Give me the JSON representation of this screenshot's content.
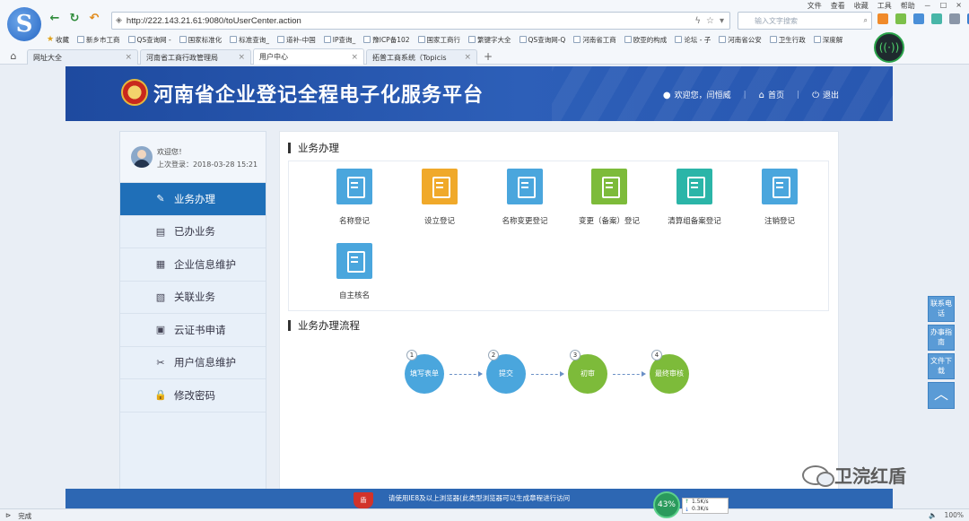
{
  "browser": {
    "system_menu": [
      "文件",
      "查看",
      "收藏",
      "工具",
      "帮助"
    ],
    "window_controls": [
      "－",
      "□",
      "×"
    ],
    "url": "http://222.143.21.61:9080/toUserCenter.action",
    "search_placeholder": "输入文字搜索",
    "bookmarks": [
      {
        "label": "收藏",
        "fav": true
      },
      {
        "label": "新乡市工商"
      },
      {
        "label": "QS查询网 -"
      },
      {
        "label": "国家标准化"
      },
      {
        "label": "标准查询_"
      },
      {
        "label": "道补-中国"
      },
      {
        "label": "IP查询_"
      },
      {
        "label": "豫ICP备102"
      },
      {
        "label": "国家工商行"
      },
      {
        "label": "繁键字大全"
      },
      {
        "label": "QS查询网-Q"
      },
      {
        "label": "河南省工商"
      },
      {
        "label": "欧亚的构成"
      },
      {
        "label": "论坛 - 子"
      },
      {
        "label": "河南省公安"
      },
      {
        "label": "卫生行政"
      },
      {
        "label": "深度解"
      }
    ],
    "tabs": [
      {
        "label": "网址大全",
        "active": false
      },
      {
        "label": "河南省工商行政管理局",
        "active": false
      },
      {
        "label": "用户中心",
        "active": true
      },
      {
        "label": "拓普工商系统（Topicis",
        "active": false
      }
    ],
    "status_left": "完成",
    "status_right": [
      "100%"
    ],
    "speed": {
      "percent": "43%",
      "up": "1.5K/s",
      "down": "0.3K/s"
    }
  },
  "header": {
    "site_title": "河南省企业登记全程电子化服务平台",
    "welcome_link": "欢迎您，闫恒威",
    "home_link": "首页",
    "logout_link": "退出"
  },
  "sidebar": {
    "welcome": "欢迎您！",
    "last_login": "上次登录：2018-03-28 15:21",
    "items": [
      {
        "label": "业务办理",
        "icon": "edit-icon",
        "glyph": "✎",
        "active": true
      },
      {
        "label": "已办业务",
        "icon": "document-icon",
        "glyph": "▤",
        "active": false
      },
      {
        "label": "企业信息维护",
        "icon": "building-icon",
        "glyph": "▦",
        "active": false
      },
      {
        "label": "关联业务",
        "icon": "search-doc-icon",
        "glyph": "▧",
        "active": false
      },
      {
        "label": "云证书申请",
        "icon": "certificate-icon",
        "glyph": "▣",
        "active": false
      },
      {
        "label": "用户信息维护",
        "icon": "tools-icon",
        "glyph": "✂",
        "active": false
      },
      {
        "label": "修改密码",
        "icon": "lock-icon",
        "glyph": "🔒",
        "active": false
      }
    ]
  },
  "main": {
    "section1_title": "业务办理",
    "section2_title": "业务办理流程",
    "business_items": [
      {
        "label": "名称登记",
        "color": "#4aa6dd",
        "icon": "name-register-icon"
      },
      {
        "label": "设立登记",
        "color": "#f0a92a",
        "icon": "establish-register-icon"
      },
      {
        "label": "名称变更登记",
        "color": "#4aa6dd",
        "icon": "name-change-icon"
      },
      {
        "label": "变更（备案）登记",
        "color": "#7dbb3a",
        "icon": "change-record-icon"
      },
      {
        "label": "清算组备案登记",
        "color": "#2bb5a8",
        "icon": "liquidation-icon"
      },
      {
        "label": "注销登记",
        "color": "#4aa6dd",
        "icon": "cancel-register-icon"
      },
      {
        "label": "自主核名",
        "color": "#4aa6dd",
        "icon": "self-name-check-icon"
      }
    ],
    "flow_steps": [
      {
        "num": "1",
        "label": "填写表单",
        "color": "#4aa6dd"
      },
      {
        "num": "2",
        "label": "提交",
        "color": "#4aa6dd"
      },
      {
        "num": "3",
        "label": "初审",
        "color": "#7dbb3a"
      },
      {
        "num": "4",
        "label": "最终审核",
        "color": "#7dbb3a"
      }
    ]
  },
  "float_buttons": [
    "联系电话",
    "办事指南",
    "文件下载"
  ],
  "footer": {
    "notice": "请使用IE8及以上浏览器(此类型浏览器可以生成章程进行访问"
  },
  "watermark": "卫浣红盾"
}
